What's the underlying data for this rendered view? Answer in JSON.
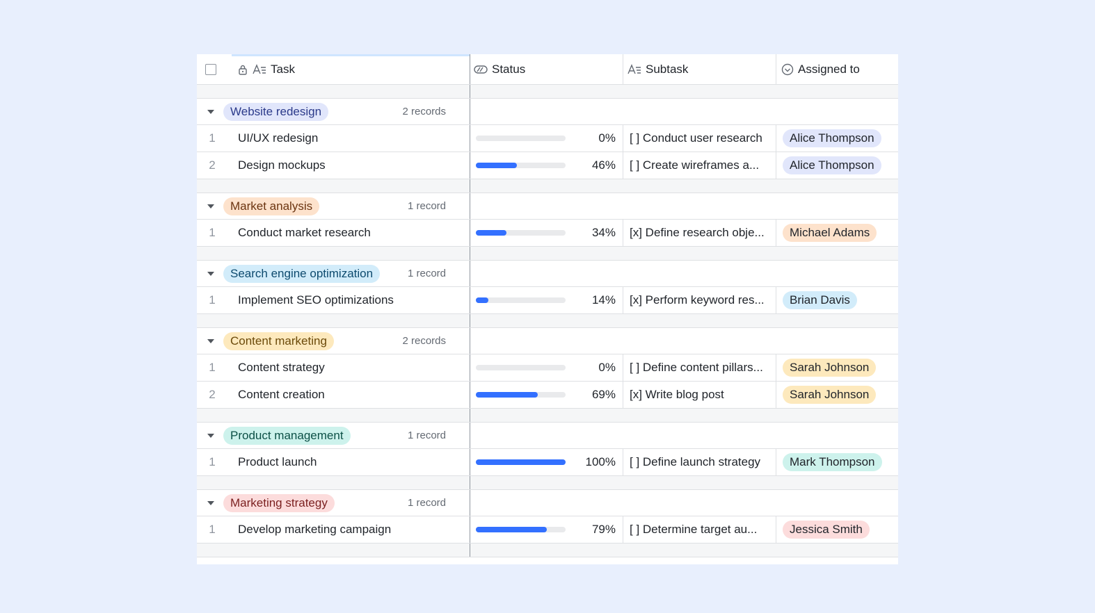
{
  "header": {
    "task": "Task",
    "status": "Status",
    "subtask": "Subtask",
    "assigned": "Assigned to"
  },
  "groups": [
    {
      "name": "Website redesign",
      "count": "2 records",
      "color": "#e1e6fb",
      "text_color": "#2b3a8a",
      "rows": [
        {
          "idx": "1",
          "task": "UI/UX redesign",
          "progress": 0,
          "pct": "0%",
          "subtask": "[ ] Conduct user research",
          "person": "Alice Thompson"
        },
        {
          "idx": "2",
          "task": "Design mockups",
          "progress": 46,
          "pct": "46%",
          "subtask": "[ ] Create wireframes a...",
          "person": "Alice Thompson"
        }
      ]
    },
    {
      "name": "Market analysis",
      "count": "1 record",
      "color": "#fde2cc",
      "text_color": "#6b3410",
      "rows": [
        {
          "idx": "1",
          "task": "Conduct market research",
          "progress": 34,
          "pct": "34%",
          "subtask": "[x] Define research obje...",
          "person": "Michael Adams"
        }
      ]
    },
    {
      "name": "Search engine optimization",
      "count": "1 record",
      "color": "#d2ecfa",
      "text_color": "#0d4a6e",
      "rows": [
        {
          "idx": "1",
          "task": "Implement SEO optimizations",
          "progress": 14,
          "pct": "14%",
          "subtask": "[x] Perform keyword res...",
          "person": "Brian Davis"
        }
      ]
    },
    {
      "name": "Content marketing",
      "count": "2 records",
      "color": "#fde9bd",
      "text_color": "#6b4a0a",
      "rows": [
        {
          "idx": "1",
          "task": "Content strategy",
          "progress": 0,
          "pct": "0%",
          "subtask": "[ ] Define content pillars...",
          "person": "Sarah Johnson"
        },
        {
          "idx": "2",
          "task": "Content creation",
          "progress": 69,
          "pct": "69%",
          "subtask": "[x] Write blog post",
          "person": "Sarah Johnson"
        }
      ]
    },
    {
      "name": "Product management",
      "count": "1 record",
      "color": "#cdf2ec",
      "text_color": "#0c5046",
      "rows": [
        {
          "idx": "1",
          "task": "Product launch",
          "progress": 100,
          "pct": "100%",
          "subtask": "[ ] Define launch strategy",
          "person": "Mark Thompson"
        }
      ]
    },
    {
      "name": "Marketing strategy",
      "count": "1 record",
      "color": "#fcdcdc",
      "text_color": "#7a1f1f",
      "rows": [
        {
          "idx": "1",
          "task": "Develop marketing campaign",
          "progress": 79,
          "pct": "79%",
          "subtask": "[ ] Determine target au...",
          "person": "Jessica Smith"
        }
      ]
    }
  ]
}
